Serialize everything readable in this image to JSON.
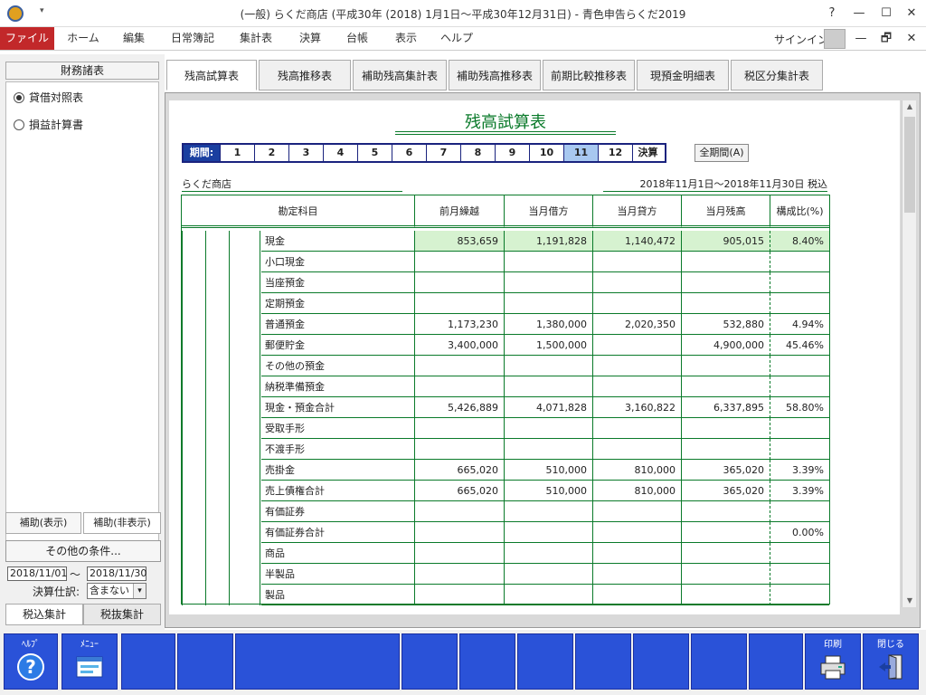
{
  "window": {
    "title": "(一般) らくだ商店 (平成30年 (2018) 1月1日～平成30年12月31日) - 青色申告らくだ2019",
    "qa_arrow": "▾",
    "help": "?",
    "minimize": "—",
    "maximize": "☐",
    "close": "✕",
    "restore": "🗗",
    "close2": "✕"
  },
  "menu": {
    "items": [
      "ファイル",
      "ホーム",
      "編集",
      "日常簿記",
      "集計表",
      "決算",
      "台帳",
      "表示",
      "ヘルプ"
    ],
    "signin": "サインイン"
  },
  "left": {
    "header": "財務諸表",
    "reports": [
      "貸借対照表",
      "損益計算書"
    ],
    "sub_tabs": [
      "補助(表示)",
      "補助(非表示)"
    ],
    "other_button": "その他の条件...",
    "date_from": "2018/11/01",
    "date_tilde": "～",
    "date_to": "2018/11/30",
    "settle_label": "決算仕訳:",
    "settle_value": "含まない",
    "tax_tabs": [
      "税込集計",
      "税抜集計"
    ]
  },
  "tabs": [
    "残高試算表",
    "残高推移表",
    "補助残高集計表",
    "補助残高推移表",
    "前期比較推移表",
    "現預金明細表",
    "税区分集計表"
  ],
  "report": {
    "title": "残高試算表",
    "period_label": "期間:",
    "periods": [
      "1",
      "2",
      "3",
      "4",
      "5",
      "6",
      "7",
      "8",
      "9",
      "10",
      "11",
      "12",
      "決算"
    ],
    "active_period": "11",
    "full_period_button": "全期間(A)",
    "company": "らくだ商店",
    "range": "2018年11月1日～2018年11月30日  税込",
    "headers": [
      "勘定科目",
      "前月繰越",
      "当月借方",
      "当月貸方",
      "当月残高",
      "構成比(%)"
    ],
    "rows": [
      {
        "name": "現金",
        "prev": "853,659",
        "debit": "1,191,828",
        "credit": "1,140,472",
        "bal": "905,015",
        "ratio": "8.40%"
      },
      {
        "name": "小口現金",
        "prev": "",
        "debit": "",
        "credit": "",
        "bal": "",
        "ratio": ""
      },
      {
        "name": "当座預金",
        "prev": "",
        "debit": "",
        "credit": "",
        "bal": "",
        "ratio": ""
      },
      {
        "name": "定期預金",
        "prev": "",
        "debit": "",
        "credit": "",
        "bal": "",
        "ratio": ""
      },
      {
        "name": "普通預金",
        "prev": "1,173,230",
        "debit": "1,380,000",
        "credit": "2,020,350",
        "bal": "532,880",
        "ratio": "4.94%"
      },
      {
        "name": "郵便貯金",
        "prev": "3,400,000",
        "debit": "1,500,000",
        "credit": "",
        "bal": "4,900,000",
        "ratio": "45.46%"
      },
      {
        "name": "その他の預金",
        "prev": "",
        "debit": "",
        "credit": "",
        "bal": "",
        "ratio": ""
      },
      {
        "name": "納税準備預金",
        "prev": "",
        "debit": "",
        "credit": "",
        "bal": "",
        "ratio": ""
      },
      {
        "name": "現金・預金合計",
        "prev": "5,426,889",
        "debit": "4,071,828",
        "credit": "3,160,822",
        "bal": "6,337,895",
        "ratio": "58.80%"
      },
      {
        "name": "受取手形",
        "prev": "",
        "debit": "",
        "credit": "",
        "bal": "",
        "ratio": ""
      },
      {
        "name": "不渡手形",
        "prev": "",
        "debit": "",
        "credit": "",
        "bal": "",
        "ratio": ""
      },
      {
        "name": "売掛金",
        "prev": "665,020",
        "debit": "510,000",
        "credit": "810,000",
        "bal": "365,020",
        "ratio": "3.39%"
      },
      {
        "name": "売上債権合計",
        "prev": "665,020",
        "debit": "510,000",
        "credit": "810,000",
        "bal": "365,020",
        "ratio": "3.39%"
      },
      {
        "name": "有価証券",
        "prev": "",
        "debit": "",
        "credit": "",
        "bal": "",
        "ratio": ""
      },
      {
        "name": "有価証券合計",
        "prev": "",
        "debit": "",
        "credit": "",
        "bal": "",
        "ratio": "0.00%"
      },
      {
        "name": "商品",
        "prev": "",
        "debit": "",
        "credit": "",
        "bal": "",
        "ratio": ""
      },
      {
        "name": "半製品",
        "prev": "",
        "debit": "",
        "credit": "",
        "bal": "",
        "ratio": ""
      },
      {
        "name": "製品",
        "prev": "",
        "debit": "",
        "credit": "",
        "bal": "",
        "ratio": ""
      }
    ]
  },
  "fkeys": {
    "help": "ﾍﾙﾌﾟ",
    "menu": "ﾒﾆｭｰ",
    "print": "印刷",
    "close": "閉じる"
  },
  "colors": {
    "file_menu": "#c2282a",
    "accent_green": "#0a7a2a",
    "fkey_blue": "#2a52d8",
    "period_blue": "#1a3fa0",
    "highlight_row": "#d6f2d0"
  }
}
